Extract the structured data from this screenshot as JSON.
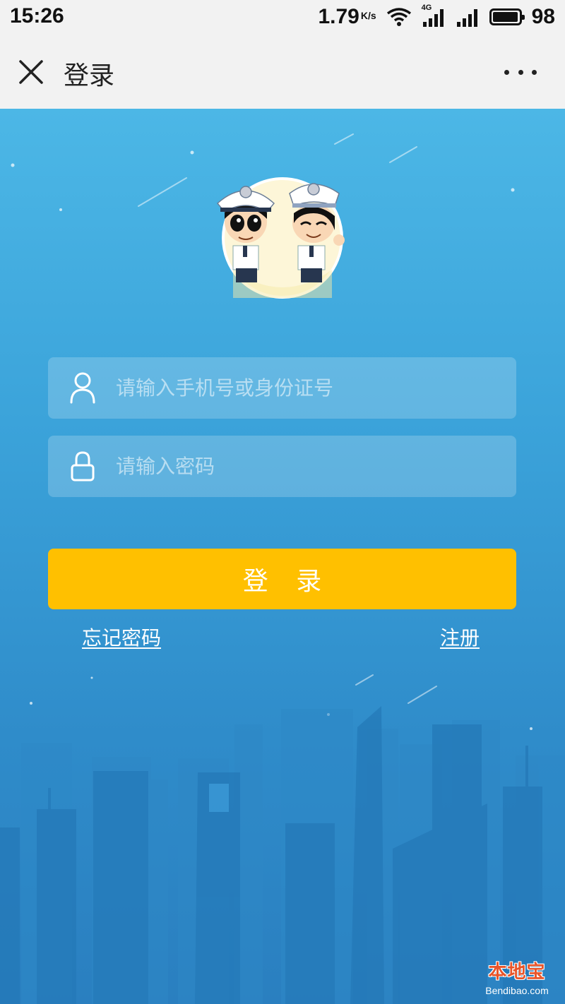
{
  "status_bar": {
    "time": "15:26",
    "net_speed": "1.79",
    "net_unit": "K/s",
    "network_type": "4G",
    "battery_level": "98",
    "battery_fraction": 0.98,
    "icons": [
      "wifi-icon",
      "signal-4g-icon",
      "signal-icon",
      "battery-icon"
    ]
  },
  "nav": {
    "title": "登录",
    "close_icon": "close-icon",
    "more_icon": "more-icon"
  },
  "form": {
    "username": {
      "placeholder": "请输入手机号或身份证号",
      "value": "",
      "icon": "user-icon"
    },
    "password": {
      "placeholder": "请输入密码",
      "value": "",
      "icon": "lock-icon"
    },
    "login_label": "登 录",
    "forgot_label": "忘记密码",
    "register_label": "注册"
  },
  "watermark": {
    "logo": "本地宝",
    "url": "Bendibao.com"
  },
  "colors": {
    "background_top": "#4cb7e6",
    "background_bottom": "#2a7fc0",
    "login_button": "#ffc000",
    "nav_background": "#f2f2f2"
  }
}
